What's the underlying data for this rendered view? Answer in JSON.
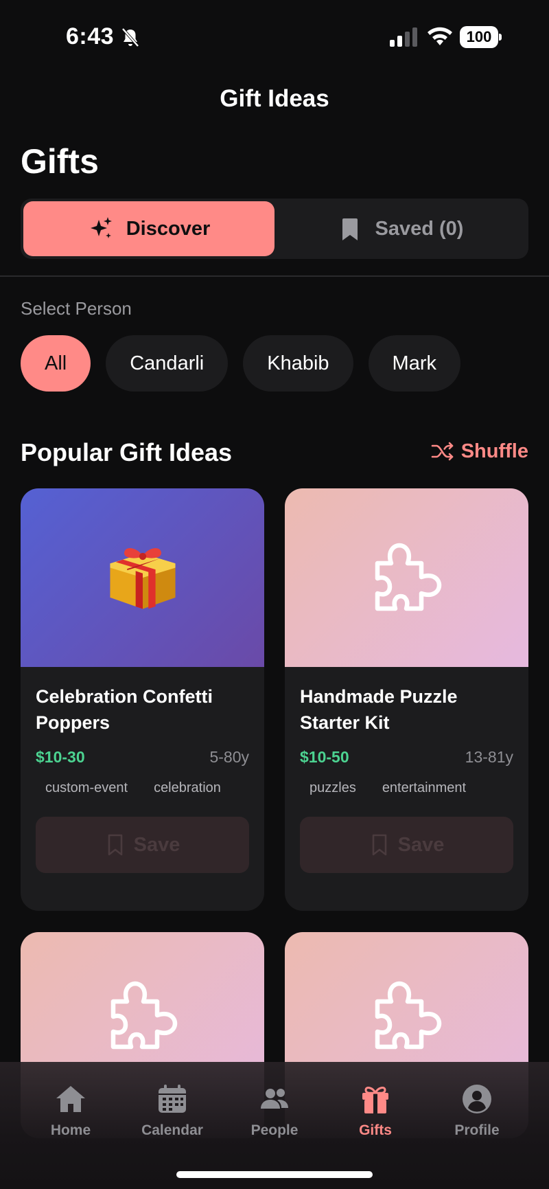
{
  "status_bar": {
    "time": "6:43",
    "battery": "100"
  },
  "nav": {
    "title": "Gift Ideas"
  },
  "page": {
    "title": "Gifts"
  },
  "segments": [
    {
      "label": "Discover",
      "icon": "sparkles-icon",
      "active": true
    },
    {
      "label": "Saved (0)",
      "icon": "bookmark-icon",
      "active": false
    }
  ],
  "person_select": {
    "label": "Select Person",
    "options": [
      "All",
      "Candarli",
      "Khabib",
      "Mark"
    ],
    "selected": "All"
  },
  "popular": {
    "title": "Popular Gift Ideas",
    "shuffle_label": "Shuffle"
  },
  "cards": [
    {
      "title": "Celebration Confetti Poppers",
      "price": "$10-30",
      "age": "5-80y",
      "tags": [
        "custom-event",
        "celebration"
      ],
      "icon": "gift-box-icon",
      "save_label": "Save"
    },
    {
      "title": "Handmade Puzzle Starter Kit",
      "price": "$10-50",
      "age": "13-81y",
      "tags": [
        "puzzles",
        "entertainment"
      ],
      "icon": "puzzle-icon",
      "save_label": "Save"
    },
    {
      "icon": "puzzle-icon"
    },
    {
      "icon": "puzzle-icon"
    }
  ],
  "tabbar": {
    "items": [
      {
        "label": "Home",
        "icon": "home-icon"
      },
      {
        "label": "Calendar",
        "icon": "calendar-icon"
      },
      {
        "label": "People",
        "icon": "people-icon"
      },
      {
        "label": "Gifts",
        "icon": "gift-icon",
        "active": true
      },
      {
        "label": "Profile",
        "icon": "profile-icon"
      }
    ]
  },
  "colors": {
    "accent": "#ff8a87",
    "price": "#4cd391",
    "background": "#0d0d0e",
    "surface": "#1c1c1e"
  }
}
